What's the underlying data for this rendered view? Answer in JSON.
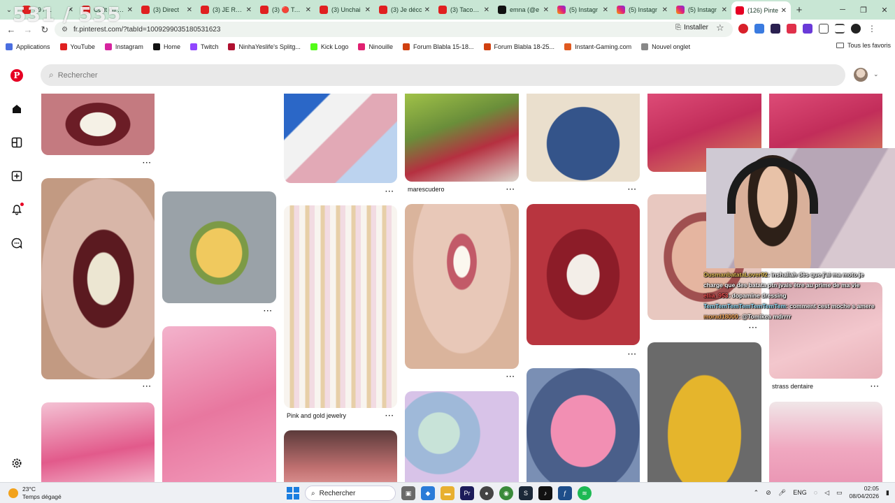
{
  "overlay": {
    "counter": "531 / 535"
  },
  "browser": {
    "tabs": [
      {
        "title": "69 / ...",
        "favicon": "youtube-icon"
      },
      {
        "title": "Coût du s...",
        "favicon": "youtube-icon"
      },
      {
        "title": "(3) Direct",
        "favicon": "youtube-icon"
      },
      {
        "title": "(3) JE RÉPO",
        "favicon": "youtube-icon"
      },
      {
        "title": "(3) 🔴 Taco",
        "favicon": "youtube-icon"
      },
      {
        "title": "(3) Unchai",
        "favicon": "youtube-icon"
      },
      {
        "title": "(3) Je décc",
        "favicon": "youtube-icon"
      },
      {
        "title": "(3) Tacos T",
        "favicon": "youtube-icon"
      },
      {
        "title": "emna (@e",
        "favicon": "tiktok-icon"
      },
      {
        "title": "(5) Instagr",
        "favicon": "instagram-icon"
      },
      {
        "title": "(5) Instagr",
        "favicon": "instagram-icon"
      },
      {
        "title": "(5) Instagr",
        "favicon": "instagram-icon"
      },
      {
        "title": "(126) Pinte",
        "favicon": "pinterest-icon",
        "active": true
      }
    ],
    "url": "fr.pinterest.com/?tabId=1009299035180531623",
    "install_label": "Installer",
    "bookmarks": [
      {
        "label": "Applications",
        "color": "#4a6ee0"
      },
      {
        "label": "YouTube",
        "color": "#e02020"
      },
      {
        "label": "Instagram",
        "color": "#d6249f"
      },
      {
        "label": "Home",
        "color": "#111111"
      },
      {
        "label": "Twitch",
        "color": "#9146ff"
      },
      {
        "label": "NinhaYeslife's Splitg...",
        "color": "#b01030"
      },
      {
        "label": "Kick Logo",
        "color": "#53fc18"
      },
      {
        "label": "Ninouille",
        "color": "#e02070"
      },
      {
        "label": "Forum Blabla 15-18...",
        "color": "#d04010"
      },
      {
        "label": "Forum Blabla 18-25...",
        "color": "#d04010"
      },
      {
        "label": "Instant-Gaming.com",
        "color": "#e05a20"
      },
      {
        "label": "Nouvel onglet",
        "color": "#888888"
      }
    ],
    "bookmarks_right": "Tous les favoris"
  },
  "pinterest": {
    "search_placeholder": "Rechercher",
    "pins": [
      {
        "title": "marescudero"
      },
      {
        "title": "Pink and gold jewelry"
      },
      {
        "title": "strass dentaire"
      }
    ]
  },
  "chat": [
    {
      "user": "OusmanbatataLover92",
      "message": ": inshallah dès que j'ai ma moto je",
      "color_class": "name-gold"
    },
    {
      "user": "",
      "message": "charge que des batata ptn jvais être au prime de ma vie",
      "color_class": ""
    },
    {
      "user": "ellia_953",
      "message": ": dopamine dressing",
      "color_class": "name-red"
    },
    {
      "user": "TemTemTemTemTemTemTem",
      "message": ": comment cest moche s amere",
      "color_class": "name-cyan"
    },
    {
      "user": "morad18000",
      "message": ": @Tomikea mdrrrr",
      "color_class": "name-orange"
    }
  ],
  "taskbar": {
    "temperature": "23°C",
    "weather": "Temps dégagé",
    "search_label": "Rechercher",
    "lang": "ENG",
    "time": "02:05",
    "date": "08/04/2026"
  }
}
